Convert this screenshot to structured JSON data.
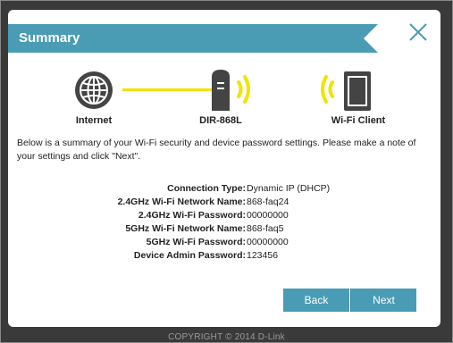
{
  "dialog": {
    "title": "Summary",
    "close_icon": "close-x-icon",
    "accent_color": "#4a9cb4"
  },
  "topology": {
    "internet": {
      "label": "Internet",
      "icon": "globe-icon"
    },
    "router": {
      "label": "DIR-868L",
      "icon": "router-icon"
    },
    "client": {
      "label": "Wi-Fi Client",
      "icon": "tablet-icon"
    },
    "link_color": "#f2e300"
  },
  "intro_text": "Below is a summary of your Wi-Fi security and device password settings. Please make a note of your settings and click \"Next\".",
  "settings": [
    {
      "label": "Connection Type:",
      "value": "Dynamic IP (DHCP)"
    },
    {
      "label": "2.4GHz Wi-Fi Network Name:",
      "value": "868-faq24"
    },
    {
      "label": "2.4GHz Wi-Fi Password:",
      "value": "00000000"
    },
    {
      "label": "5GHz Wi-Fi Network Name:",
      "value": "868-faq5"
    },
    {
      "label": "5GHz Wi-Fi Password:",
      "value": "00000000"
    },
    {
      "label": "Device Admin Password:",
      "value": "123456"
    }
  ],
  "buttons": {
    "back": "Back",
    "next": "Next"
  },
  "footer": "COPYRIGHT © 2014 D-Link"
}
